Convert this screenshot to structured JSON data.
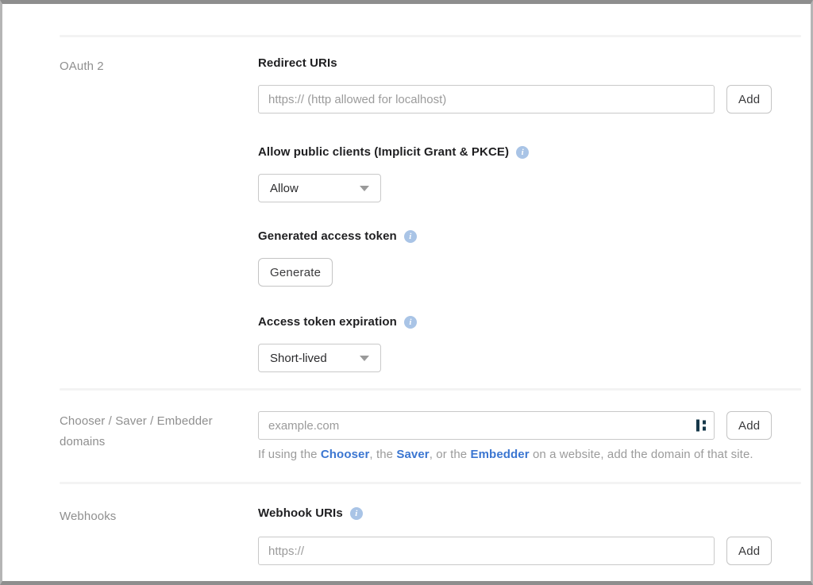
{
  "colors": {
    "link_blue": "#3b76d1",
    "info_icon_bg": "#a9c4e6",
    "heading_text": "#1f1f21",
    "muted_label": "#8f8f8f",
    "placeholder": "#9b9b9b",
    "input_border": "#c9c9c9",
    "frame_border": "#8e8e8e",
    "cursor_icon": "#16384a"
  },
  "icons": {
    "info_glyph": "i"
  },
  "oauth2": {
    "section_label": "OAuth 2",
    "redirect_uris": {
      "heading": "Redirect URIs",
      "input_value": "",
      "input_placeholder": "https:// (http allowed for localhost)",
      "add_button": "Add"
    },
    "public_clients": {
      "heading": "Allow public clients (Implicit Grant & PKCE)",
      "selected_option": "Allow"
    },
    "generated_token": {
      "heading": "Generated access token",
      "generate_button": "Generate"
    },
    "token_expiration": {
      "heading": "Access token expiration",
      "selected_option": "Short-lived"
    }
  },
  "domains": {
    "section_label": "Chooser / Saver / Embedder domains",
    "input_value": "",
    "input_placeholder": "example.com",
    "add_button": "Add",
    "hint": {
      "part1": "If using the ",
      "link_chooser": "Chooser",
      "part2": ", the ",
      "link_saver": "Saver",
      "part3": ", or the ",
      "link_embedder": "Embedder",
      "part4": " on a website, add the domain of that site."
    }
  },
  "webhooks": {
    "section_label": "Webhooks",
    "heading": "Webhook URIs",
    "input_value": "",
    "input_placeholder": "https://",
    "add_button": "Add"
  }
}
